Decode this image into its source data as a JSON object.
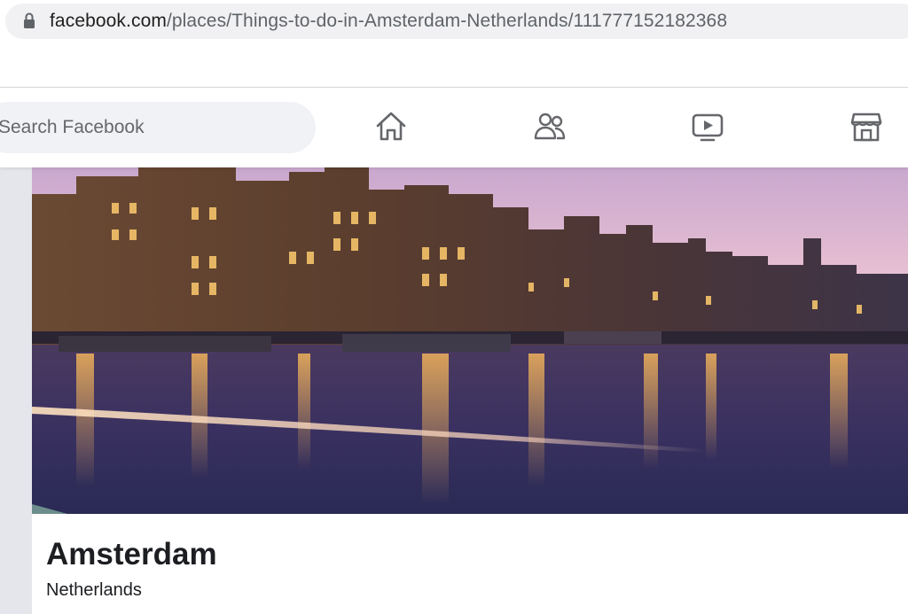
{
  "browser": {
    "url_domain": "facebook.com",
    "url_path": "/places/Things-to-do-in-Amsterdam-Netherlands/111777152182368",
    "lock_icon": "lock-icon"
  },
  "header": {
    "search_placeholder": "Search Facebook",
    "nav": [
      {
        "name": "home",
        "icon": "home-icon"
      },
      {
        "name": "friends",
        "icon": "friends-icon"
      },
      {
        "name": "watch",
        "icon": "video-icon"
      },
      {
        "name": "marketplace",
        "icon": "marketplace-icon"
      }
    ]
  },
  "page": {
    "title": "Amsterdam",
    "subtitle": "Netherlands",
    "cover_image": "Amsterdam canal at dusk"
  },
  "colors": {
    "header_bg": "#ffffff",
    "search_bg": "#f0f2f5",
    "rail_bg": "#e4e6eb",
    "text_primary": "#1c1e21",
    "icon_color": "#65676b"
  }
}
